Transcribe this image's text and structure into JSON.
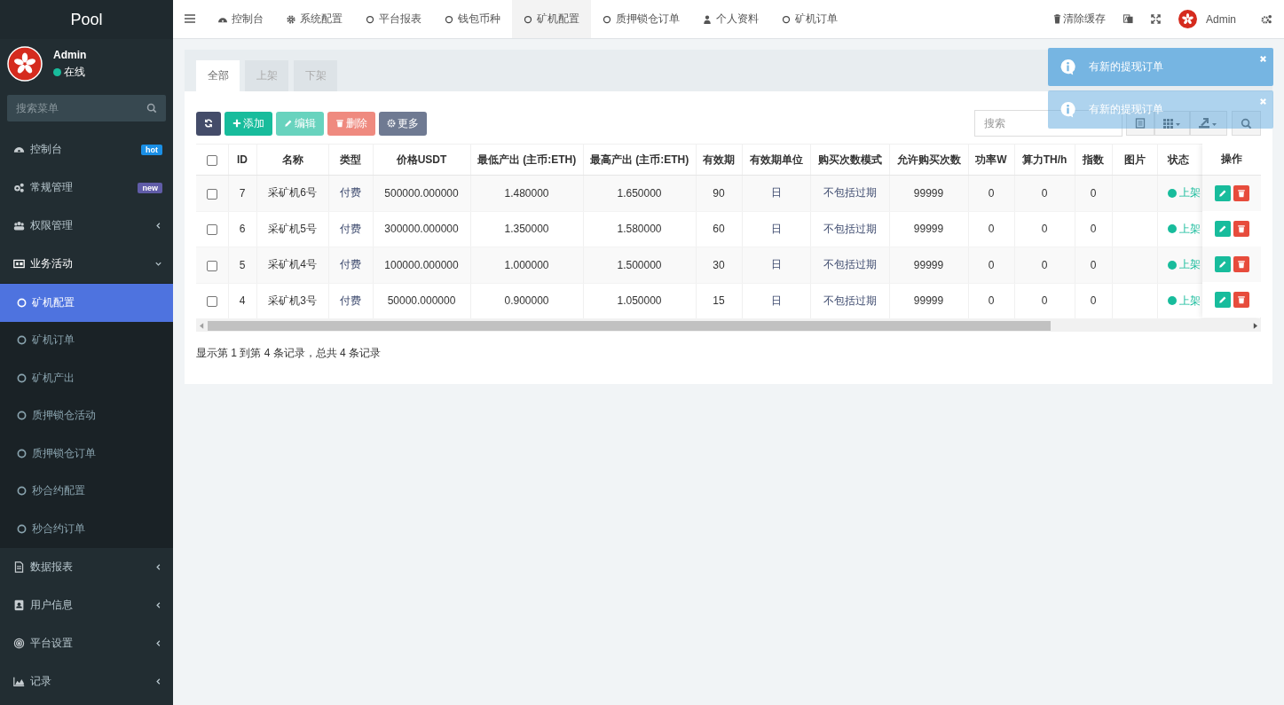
{
  "brand": "Pool",
  "user": {
    "name": "Admin",
    "status": "在线",
    "online": true
  },
  "menu_search": {
    "placeholder": "搜索菜单"
  },
  "menu": [
    {
      "kind": "link",
      "label": "控制台",
      "badge": {
        "text": "hot",
        "color": "#1a8fe6"
      }
    },
    {
      "kind": "link",
      "label": "常规管理",
      "badge": {
        "text": "new",
        "color": "#605ca8"
      }
    },
    {
      "kind": "tree",
      "label": "权限管理",
      "expanded": false
    },
    {
      "kind": "tree",
      "label": "业务活动",
      "expanded": true,
      "children": [
        {
          "label": "矿机配置",
          "selected": true
        },
        {
          "label": "矿机订单",
          "selected": false
        },
        {
          "label": "矿机产出",
          "selected": false
        },
        {
          "label": "质押锁仓活动",
          "selected": false
        },
        {
          "label": "质押锁仓订单",
          "selected": false
        },
        {
          "label": "秒合约配置",
          "selected": false
        },
        {
          "label": "秒合约订单",
          "selected": false
        }
      ]
    },
    {
      "kind": "tree",
      "label": "数据报表",
      "expanded": false
    },
    {
      "kind": "tree",
      "label": "用户信息",
      "expanded": false
    },
    {
      "kind": "tree",
      "label": "平台设置",
      "expanded": false
    },
    {
      "kind": "tree",
      "label": "记录",
      "expanded": false
    }
  ],
  "nav_tabs": [
    {
      "label": "控制台",
      "selected": false
    },
    {
      "label": "系统配置",
      "selected": false
    },
    {
      "label": "平台报表",
      "selected": false
    },
    {
      "label": "钱包币种",
      "selected": false
    },
    {
      "label": "矿机配置",
      "selected": true
    },
    {
      "label": "质押锁仓订单",
      "selected": false
    },
    {
      "label": "个人资料",
      "selected": false
    },
    {
      "label": "矿机订单",
      "selected": false
    }
  ],
  "nav_right": {
    "clear_cache": "清除缓存",
    "user": "Admin"
  },
  "panel_tabs": [
    {
      "label": "全部",
      "selected": true
    },
    {
      "label": "上架",
      "selected": false
    },
    {
      "label": "下架",
      "selected": false
    }
  ],
  "toolbar": [
    {
      "kind": "refresh",
      "disabled": false
    },
    {
      "kind": "add",
      "label": "添加",
      "disabled": false
    },
    {
      "kind": "edit",
      "label": "编辑",
      "disabled": true
    },
    {
      "kind": "delete",
      "label": "删除",
      "disabled": true
    },
    {
      "kind": "more",
      "label": "更多",
      "disabled": false
    }
  ],
  "table_search": {
    "placeholder": "搜索"
  },
  "toasts": [
    {
      "text": "有新的提现订单",
      "fading": false
    },
    {
      "text": "有新的提现订单",
      "fading": true
    }
  ],
  "table": {
    "select_all": {
      "checked": false
    },
    "columns": [
      {
        "label": "ID",
        "kind": "text"
      },
      {
        "label": "名称",
        "kind": "text"
      },
      {
        "label": "类型",
        "kind": "text"
      },
      {
        "label": "价格USDT",
        "kind": "text"
      },
      {
        "label": "最低产出 (主币:ETH)",
        "kind": "text"
      },
      {
        "label": "最高产出 (主币:ETH)",
        "kind": "text"
      },
      {
        "label": "有效期",
        "kind": "text"
      },
      {
        "label": "有效期单位",
        "kind": "text"
      },
      {
        "label": "购买次数模式",
        "kind": "text"
      },
      {
        "label": "允许购买次数",
        "kind": "text"
      },
      {
        "label": "功率W",
        "kind": "text"
      },
      {
        "label": "算力TH/h",
        "kind": "text"
      },
      {
        "label": "指数",
        "kind": "text"
      },
      {
        "label": "图片",
        "kind": "image"
      },
      {
        "label": "状态",
        "kind": "status"
      }
    ],
    "actions_label": "操作",
    "rows": [
      {
        "checked": false,
        "cells": [
          "7",
          "采矿机6号",
          "付费",
          "500000.000000",
          "1.480000",
          "1.650000",
          "90",
          "日",
          "不包括过期",
          "99999",
          "0",
          "0",
          "0"
        ],
        "status": {
          "text": "上架",
          "color": "#18bc9c"
        }
      },
      {
        "checked": false,
        "cells": [
          "6",
          "采矿机5号",
          "付费",
          "300000.000000",
          "1.350000",
          "1.580000",
          "60",
          "日",
          "不包括过期",
          "99999",
          "0",
          "0",
          "0"
        ],
        "status": {
          "text": "上架",
          "color": "#18bc9c"
        }
      },
      {
        "checked": false,
        "cells": [
          "5",
          "采矿机4号",
          "付费",
          "100000.000000",
          "1.000000",
          "1.500000",
          "30",
          "日",
          "不包括过期",
          "99999",
          "0",
          "0",
          "0"
        ],
        "status": {
          "text": "上架",
          "color": "#18bc9c"
        }
      },
      {
        "checked": false,
        "cells": [
          "4",
          "采矿机3号",
          "付费",
          "50000.000000",
          "0.900000",
          "1.050000",
          "15",
          "日",
          "不包括过期",
          "99999",
          "0",
          "0",
          "0"
        ],
        "status": {
          "text": "上架",
          "color": "#18bc9c"
        }
      }
    ]
  },
  "pagination_info": "显示第 1 到第 4 条记录，总共 4 条记录"
}
